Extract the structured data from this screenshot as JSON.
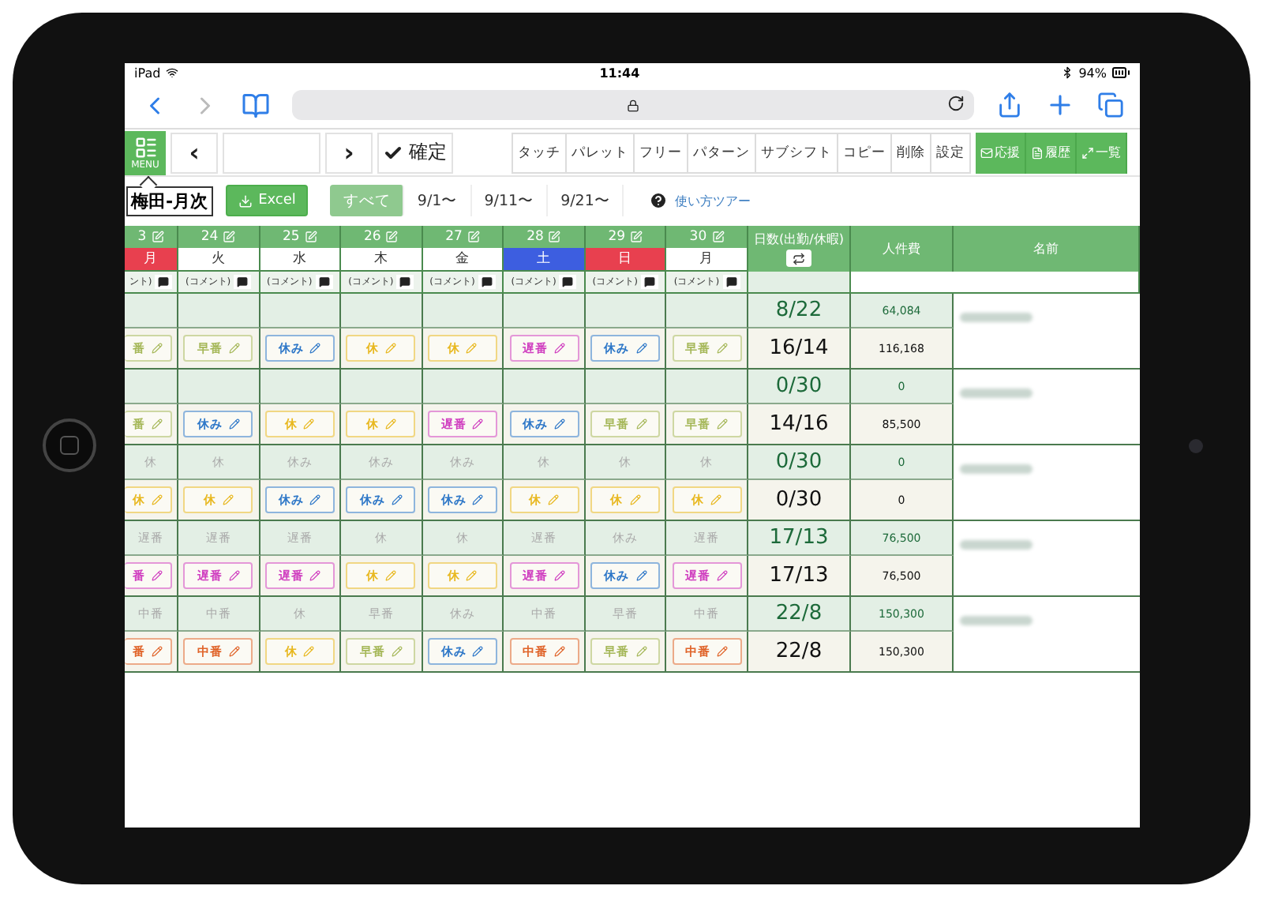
{
  "status_bar": {
    "device": "iPad",
    "time": "11:44",
    "battery": "94%"
  },
  "toolbar": {
    "menu": "MENU",
    "tooltip": "梅田-月次",
    "prev": "‹",
    "next": "›",
    "confirm": "確定",
    "tools": [
      "タッチ",
      "パレット",
      "フリー",
      "パターン",
      "サブシフト",
      "コピー",
      "削除",
      "設定"
    ],
    "green_tools": [
      "応援",
      "履歴",
      "一覧"
    ]
  },
  "filter": {
    "excel": "Excel",
    "tabs": [
      {
        "label": "すべて",
        "selected": true
      },
      {
        "label": "9/1〜",
        "selected": false
      },
      {
        "label": "9/11〜",
        "selected": false
      },
      {
        "label": "9/21〜",
        "selected": false
      }
    ],
    "help": "使い方ツアー"
  },
  "days": [
    {
      "date": "3",
      "weekday": "月",
      "kind": "holiday",
      "comment": "ント)"
    },
    {
      "date": "24",
      "weekday": "火",
      "kind": "weekday",
      "comment": "(コメント)"
    },
    {
      "date": "25",
      "weekday": "水",
      "kind": "weekday",
      "comment": "(コメント)"
    },
    {
      "date": "26",
      "weekday": "木",
      "kind": "weekday",
      "comment": "(コメント)"
    },
    {
      "date": "27",
      "weekday": "金",
      "kind": "weekday",
      "comment": "(コメント)"
    },
    {
      "date": "28",
      "weekday": "土",
      "kind": "saturday",
      "comment": "(コメント)"
    },
    {
      "date": "29",
      "weekday": "日",
      "kind": "holiday",
      "comment": "(コメント)"
    },
    {
      "date": "30",
      "weekday": "月",
      "kind": "weekday",
      "comment": "(コメント)"
    }
  ],
  "columns": {
    "days": "日数(出勤/休暇)",
    "cost": "人件費",
    "name": "名前"
  },
  "employees": [
    {
      "shifts": [
        {
          "label": "番",
          "kind": "early"
        },
        {
          "label": "早番",
          "kind": "early"
        },
        {
          "label": "休み",
          "kind": "off"
        },
        {
          "label": "休",
          "kind": "rest"
        },
        {
          "label": "休",
          "kind": "rest"
        },
        {
          "label": "遅番",
          "kind": "late"
        },
        {
          "label": "休み",
          "kind": "off"
        },
        {
          "label": "早番",
          "kind": "early"
        }
      ],
      "plan_days": "8/22",
      "days": "16/14",
      "plan_cost": "64,084",
      "cost": "116,168"
    },
    {
      "shifts": [
        {
          "label": "番",
          "kind": "early"
        },
        {
          "label": "休み",
          "kind": "off"
        },
        {
          "label": "休",
          "kind": "rest"
        },
        {
          "label": "休",
          "kind": "rest"
        },
        {
          "label": "遅番",
          "kind": "late"
        },
        {
          "label": "休み",
          "kind": "off"
        },
        {
          "label": "早番",
          "kind": "early"
        },
        {
          "label": "早番",
          "kind": "early"
        }
      ],
      "plan_days": "0/30",
      "days": "14/16",
      "plan_cost": "0",
      "cost": "85,500"
    },
    {
      "plan": [
        "休",
        "休",
        "休み",
        "休み",
        "休み",
        "休",
        "休",
        "休"
      ],
      "shifts": [
        {
          "label": "休",
          "kind": "rest"
        },
        {
          "label": "休",
          "kind": "rest"
        },
        {
          "label": "休み",
          "kind": "off"
        },
        {
          "label": "休み",
          "kind": "off"
        },
        {
          "label": "休み",
          "kind": "off"
        },
        {
          "label": "休",
          "kind": "rest"
        },
        {
          "label": "休",
          "kind": "rest"
        },
        {
          "label": "休",
          "kind": "rest"
        }
      ],
      "plan_days": "0/30",
      "days": "0/30",
      "plan_cost": "0",
      "cost": "0"
    },
    {
      "plan": [
        "遅番",
        "遅番",
        "遅番",
        "休",
        "休",
        "遅番",
        "休み",
        "遅番"
      ],
      "shifts": [
        {
          "label": "番",
          "kind": "late"
        },
        {
          "label": "遅番",
          "kind": "late"
        },
        {
          "label": "遅番",
          "kind": "late"
        },
        {
          "label": "休",
          "kind": "rest"
        },
        {
          "label": "休",
          "kind": "rest"
        },
        {
          "label": "遅番",
          "kind": "late"
        },
        {
          "label": "休み",
          "kind": "off"
        },
        {
          "label": "遅番",
          "kind": "late"
        }
      ],
      "plan_days": "17/13",
      "days": "17/13",
      "plan_cost": "76,500",
      "cost": "76,500"
    },
    {
      "plan": [
        "中番",
        "中番",
        "休",
        "早番",
        "休み",
        "中番",
        "早番",
        "中番"
      ],
      "shifts": [
        {
          "label": "番",
          "kind": "mid"
        },
        {
          "label": "中番",
          "kind": "mid"
        },
        {
          "label": "休",
          "kind": "rest"
        },
        {
          "label": "早番",
          "kind": "early"
        },
        {
          "label": "休み",
          "kind": "off"
        },
        {
          "label": "中番",
          "kind": "mid"
        },
        {
          "label": "早番",
          "kind": "early"
        },
        {
          "label": "中番",
          "kind": "mid"
        }
      ],
      "plan_days": "22/8",
      "days": "22/8",
      "plan_cost": "150,300",
      "cost": "150,300"
    }
  ]
}
